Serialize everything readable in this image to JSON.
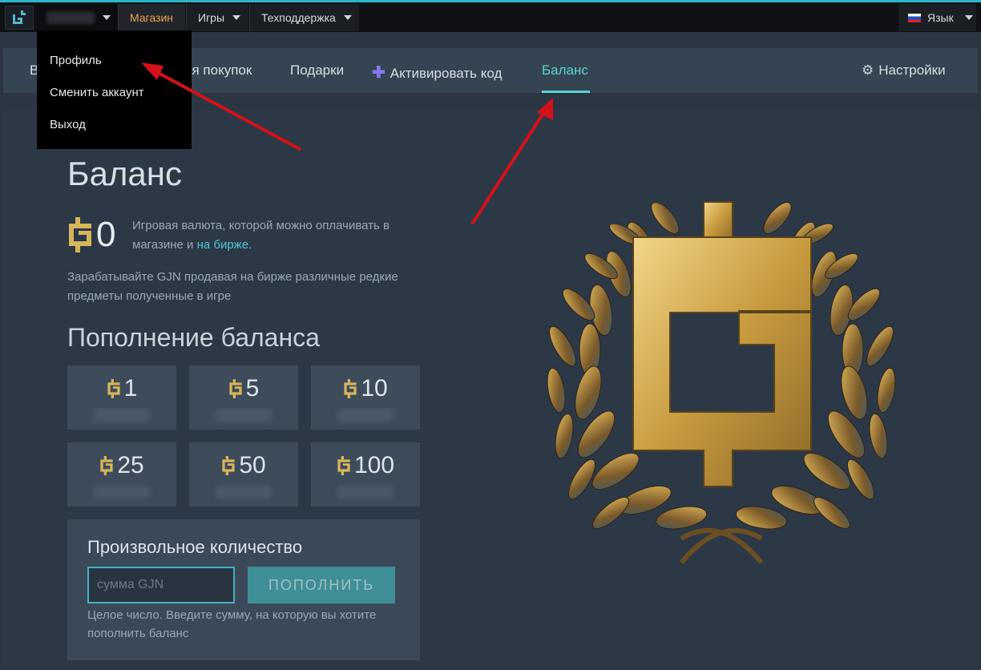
{
  "topbar": {
    "store": "Магазин",
    "games": "Игры",
    "support": "Техподдержка",
    "language": "Язык"
  },
  "account_menu": {
    "items": [
      "Профиль",
      "Сменить аккаунт",
      "Выход"
    ]
  },
  "subnav": {
    "partial_left": "В",
    "history": "ия покупок",
    "gifts": "Подарки",
    "activate": "Активировать код",
    "balance": "Баланс",
    "settings": "Настройки"
  },
  "balance": {
    "heading": "Баланс",
    "amount": "0",
    "description": "Игровая валюта, которой можно оплачивать в магазине и",
    "link": "на бирже.",
    "earn": "Зарабатывайте GJN продавая на бирже различные редкие предметы полученные в игре"
  },
  "topup": {
    "heading": "Пополнение баланса",
    "amounts": [
      "1",
      "5",
      "10",
      "25",
      "50",
      "100"
    ]
  },
  "custom": {
    "title": "Произвольное количество",
    "placeholder": "сумма GJN",
    "button": "ПОПОЛНИТЬ",
    "note": "Целое число. Введите сумму, на которую вы хотите пополнить баланс"
  },
  "colors": {
    "accent": "#5ad3d4",
    "store": "#e9a24a",
    "gold": "#d7b55a",
    "arrow": "#d4111a"
  }
}
